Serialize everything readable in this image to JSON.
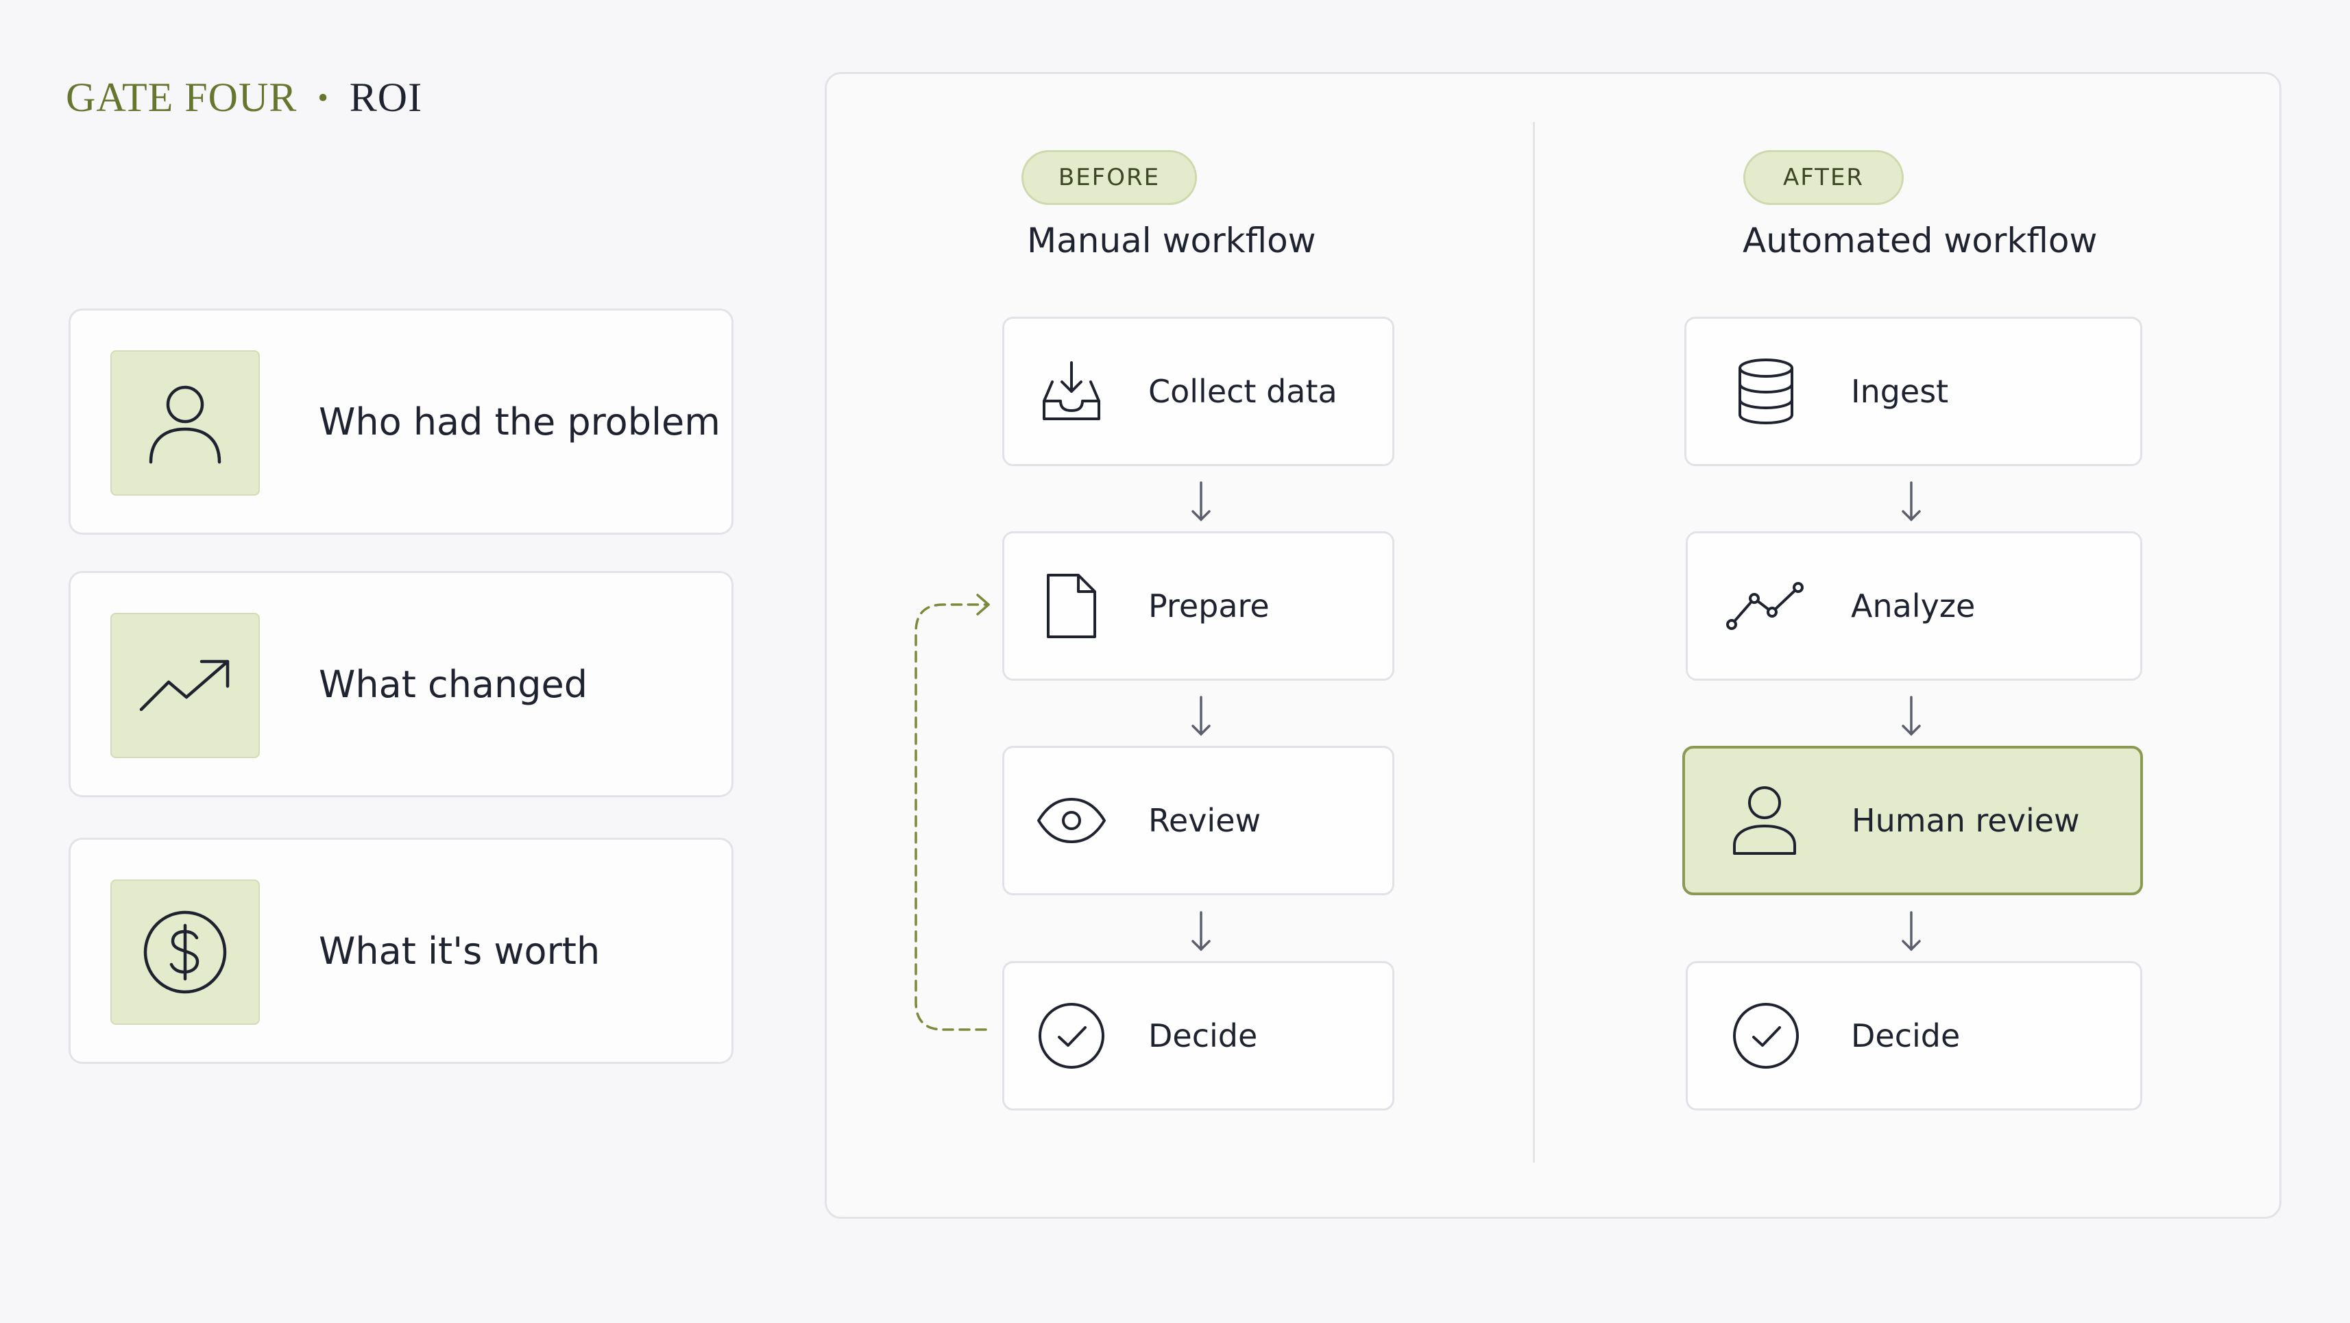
{
  "header": {
    "gate": "GATE FOUR",
    "separator": "•",
    "topic": "ROI"
  },
  "cards": [
    {
      "label": "Who had the problem",
      "icon": "user-icon"
    },
    {
      "label": "What changed",
      "icon": "trending-up-icon"
    },
    {
      "label": "What it's worth",
      "icon": "dollar-circle-icon"
    }
  ],
  "before": {
    "badge": "BEFORE",
    "title": "Manual workflow",
    "steps": [
      {
        "label": "Collect data",
        "icon": "inbox-download-icon"
      },
      {
        "label": "Prepare",
        "icon": "document-icon"
      },
      {
        "label": "Review",
        "icon": "eye-icon"
      },
      {
        "label": "Decide",
        "icon": "check-circle-icon"
      }
    ]
  },
  "after": {
    "badge": "AFTER",
    "title": "Automated workflow",
    "steps": [
      {
        "label": "Ingest",
        "icon": "database-icon"
      },
      {
        "label": "Analyze",
        "icon": "line-chart-icon"
      },
      {
        "label": "Human review",
        "icon": "user-icon",
        "highlighted": true
      },
      {
        "label": "Decide",
        "icon": "check-circle-icon"
      }
    ]
  },
  "colors": {
    "accent": "#66762f",
    "accent_fill": "#e3ebcc",
    "highlight_border": "#8a9a55",
    "text": "#1f2330"
  }
}
